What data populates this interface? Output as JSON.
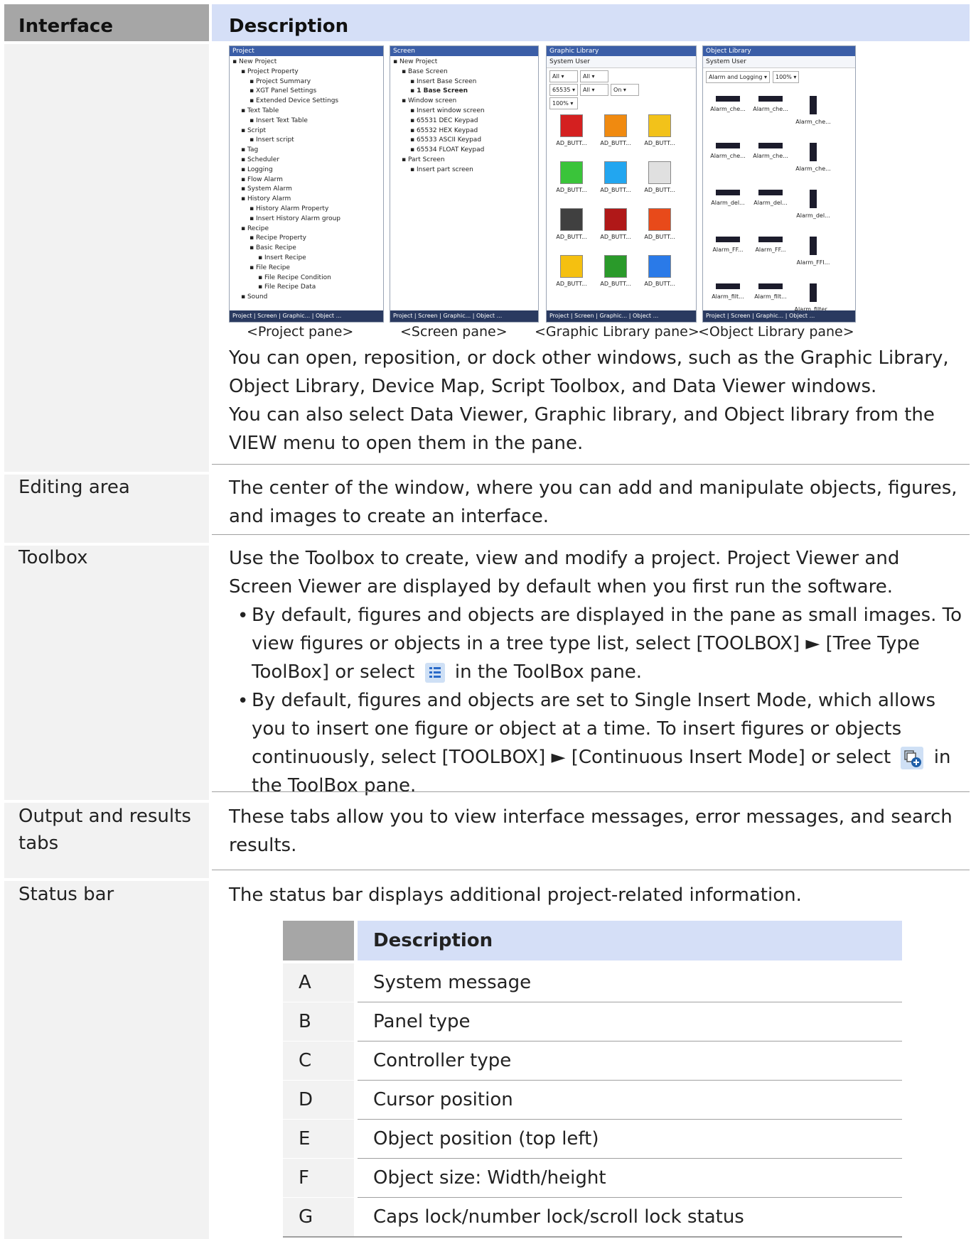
{
  "header": {
    "interface": "Interface",
    "description": "Description"
  },
  "panes": {
    "project": {
      "title": "Project",
      "caption": "<Project pane>",
      "tree": [
        "New Project",
        "Project Property",
        "Project Summary",
        "XGT Panel Settings",
        "Extended Device Settings",
        "Text Table",
        "Insert Text Table",
        "Script",
        "Insert script",
        "Tag",
        "Scheduler",
        "Logging",
        "Flow Alarm",
        "System Alarm",
        "History Alarm",
        "History Alarm Property",
        "Insert History Alarm group",
        "Recipe",
        "Recipe Property",
        "Basic Recipe",
        "Insert Recipe",
        "File Recipe",
        "File Recipe Condition",
        "File Recipe Data",
        "Sound"
      ],
      "tabs": "Project | Screen | Graphic... | Object ..."
    },
    "screen": {
      "title": "Screen",
      "caption": "<Screen pane>",
      "tree": [
        "New Project",
        "Base Screen",
        "Insert Base Screen",
        "1 Base Screen",
        "Window screen",
        "Insert window screen",
        "65531 DEC Keypad",
        "65532 HEX Keypad",
        "65533 ASCII Keypad",
        "65534 FLOAT Keypad",
        "Part Screen",
        "Insert part screen"
      ],
      "tabs": "Project | Screen | Graphic... | Object ..."
    },
    "graphic": {
      "title": "Graphic Library",
      "caption": "<Graphic Library pane>",
      "toolbar": "System  User",
      "filters": [
        "All",
        "All",
        "65535",
        "All",
        "On",
        "100%"
      ],
      "items": [
        "AD_BUTT...",
        "AD_BUTT...",
        "AD_BUTT...",
        "AD_BUTT...",
        "AD_BUTT...",
        "AD_BUTT...",
        "AD_BUTT...",
        "AD_BUTT...",
        "AD_BUTT...",
        "AD_BUTT...",
        "AD_BUTT...",
        "AD_BUTT..."
      ],
      "colors": [
        "#d42020",
        "#f08a10",
        "#f2c21a",
        "#3ac43a",
        "#22a6f0",
        "#e0e0e0",
        "#404040",
        "#b01818",
        "#e84a1a",
        "#f5c010",
        "#2a9a2a",
        "#2a7ae8"
      ],
      "tabs": "Project | Screen | Graphic... | Object ..."
    },
    "object": {
      "title": "Object Library",
      "caption": "<Object Library pane>",
      "toolbar": "System  User",
      "filters": [
        "Alarm and Logging",
        "100%"
      ],
      "items": [
        "Alarm_che...",
        "Alarm_che...",
        "Alarm_che...",
        "Alarm_che...",
        "Alarm_che...",
        "Alarm_che...",
        "Alarm_del...",
        "Alarm_del...",
        "Alarm_del...",
        "Alarm_FF...",
        "Alarm_FF...",
        "Alarm_FFI...",
        "Alarm_filt...",
        "Alarm_filt...",
        "Alarm_filter..."
      ],
      "tabs": "Project | Screen | Graphic... | Object ..."
    }
  },
  "rows": {
    "panes_desc1": "You can open, reposition, or dock other windows, such as the Graphic Library, Object Library, Device Map, Script Toolbox, and Data Viewer windows.",
    "panes_desc2": "You can also select Data Viewer, Graphic library, and Object library from the VIEW menu to open them in the pane.",
    "editing_label": "Editing area",
    "editing_desc": "The center of the window, where you can add and manipulate objects, figures, and images to create an interface.",
    "toolbox_label": "Toolbox",
    "toolbox_desc": "Use the Toolbox to create, view and modify a project. Project Viewer and Screen Viewer are displayed by default when you first run the software.",
    "toolbox_b1_a": "By default, figures and objects are displayed in the pane as small images. To view figures or objects in a tree type list, select [TOOLBOX] ► [Tree Type ToolBox] or select",
    "toolbox_b1_b": "in the ToolBox pane.",
    "toolbox_b2_a": "By default, figures and objects are set to Single Insert Mode, which allows you to insert one figure or object at a time. To insert figures or objects continuously, select [TOOLBOX] ► [Continuous Insert Mode] or select",
    "toolbox_b2_b": "in the ToolBox pane.",
    "output_label": "Output and results tabs",
    "output_desc": "These tabs allow you to view interface messages, error messages, and search results.",
    "status_label": "Status bar",
    "status_desc": "The status bar displays additional project-related information."
  },
  "status_table": {
    "header": "Description",
    "rows": [
      {
        "key": "A",
        "value": "System message"
      },
      {
        "key": "B",
        "value": "Panel type"
      },
      {
        "key": "C",
        "value": "Controller type"
      },
      {
        "key": "D",
        "value": "Cursor position"
      },
      {
        "key": "E",
        "value": "Object position (top left)"
      },
      {
        "key": "F",
        "value": "Object size: Width/height"
      },
      {
        "key": "G",
        "value": "Caps lock/number lock/scroll lock status"
      }
    ]
  },
  "icons": {
    "tree_list": "tree-type-list-icon",
    "continuous_insert": "continuous-insert-icon"
  }
}
